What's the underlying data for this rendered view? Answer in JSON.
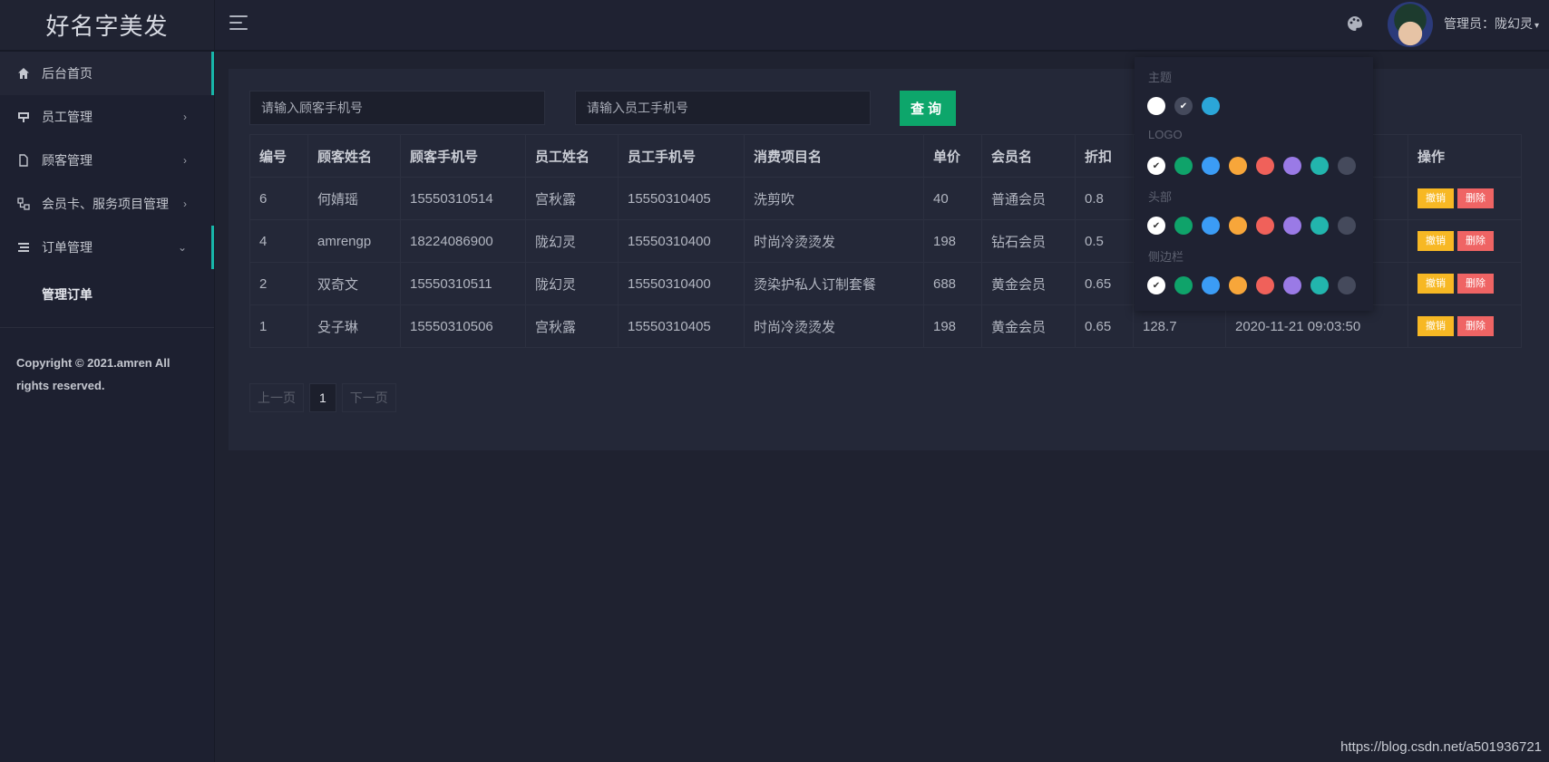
{
  "app": {
    "title": "好名字美发"
  },
  "header": {
    "user_label": "管理员：",
    "user_name": "陇幻灵",
    "user_caret": "▾"
  },
  "sidebar": {
    "items": [
      {
        "label": "后台首页"
      },
      {
        "label": "员工管理",
        "arrow": "›"
      },
      {
        "label": "顾客管理",
        "arrow": "›"
      },
      {
        "label": "会员卡、服务项目管理",
        "arrow": "›"
      },
      {
        "label": "订单管理",
        "arrow": "⌄"
      }
    ],
    "sub_item": "管理订单",
    "copyright": "Copyright © 2021.amren All rights reserved."
  },
  "search": {
    "customer_placeholder": "请输入顾客手机号",
    "employee_placeholder": "请输入员工手机号",
    "query_label": "查询"
  },
  "table": {
    "headers": [
      "编号",
      "顾客姓名",
      "顾客手机号",
      "员工姓名",
      "员工手机号",
      "消费项目名",
      "单价",
      "会员名",
      "折扣",
      "",
      "",
      "操作"
    ],
    "rows": [
      [
        "6",
        "何婧瑶",
        "15550310514",
        "宫秋露",
        "15550310405",
        "洗剪吹",
        "40",
        "普通会员",
        "0.8",
        "",
        ""
      ],
      [
        "4",
        "amrengp",
        "18224086900",
        "陇幻灵",
        "15550310400",
        "时尚冷烫烫发",
        "198",
        "钻石会员",
        "0.5",
        "",
        ""
      ],
      [
        "2",
        "双奇文",
        "15550310511",
        "陇幻灵",
        "15550310400",
        "烫染护私人订制套餐",
        "688",
        "黄金会员",
        "0.65",
        "",
        ""
      ],
      [
        "1",
        "殳子琳",
        "15550310506",
        "宫秋露",
        "15550310405",
        "时尚冷烫烫发",
        "198",
        "黄金会员",
        "0.65",
        "128.7",
        "2020-11-21 09:03:50"
      ]
    ],
    "op_cancel": "撤销",
    "op_delete": "删除"
  },
  "pager": {
    "prev": "上一页",
    "current": "1",
    "next": "下一页"
  },
  "theme_panel": {
    "theme_label": "主题",
    "logo_label": "LOGO",
    "header_label": "头部",
    "sidebar_label": "侧边栏",
    "theme_colors": [
      "#ffffff",
      "#454a5c",
      "#2ba6d8"
    ],
    "accent_colors": [
      "#ffffff",
      "#0fa36a",
      "#3b9cf5",
      "#f7a63a",
      "#f0615a",
      "#9a7ae6",
      "#22b5ad",
      "#454a5c"
    ]
  },
  "watermark": "https://blog.csdn.net/a501936721"
}
